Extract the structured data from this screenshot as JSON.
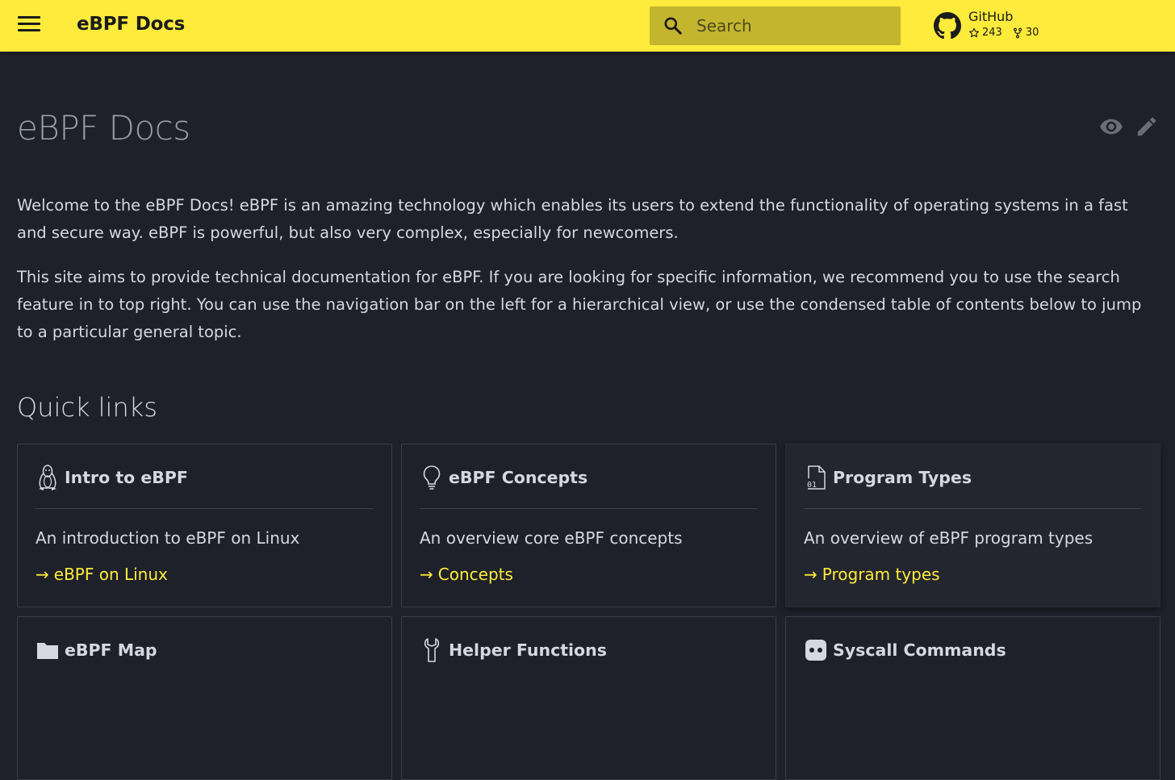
{
  "header": {
    "site_title": "eBPF Docs",
    "search_placeholder": "Search",
    "repo": {
      "name": "GitHub",
      "stars": "243",
      "forks": "30"
    },
    "accent_color": "#ffeb3b"
  },
  "page": {
    "title": "eBPF Docs",
    "paragraphs": [
      "Welcome to the eBPF Docs! eBPF is an amazing technology which enables its users to extend the functionality of operating systems in a fast and secure way. eBPF is powerful, but also very complex, especially for newcomers.",
      "This site aims to provide technical documentation for eBPF. If you are looking for specific information, we recommend you to use the search feature in to top right. You can use the navigation bar on the left for a hierarchical view, or use the condensed table of contents below to jump to a particular general topic."
    ],
    "quick_links_heading": "Quick links"
  },
  "cards": [
    {
      "icon": "linux-penguin-icon",
      "title": "Intro to eBPF",
      "description": "An introduction to eBPF on Linux",
      "link_label": "eBPF on Linux"
    },
    {
      "icon": "lightbulb-icon",
      "title": "eBPF Concepts",
      "description": "An overview core eBPF concepts",
      "link_label": "Concepts"
    },
    {
      "icon": "binary-file-icon",
      "title": "Program Types",
      "description": "An overview of eBPF program types",
      "link_label": "Program types"
    },
    {
      "icon": "folder-icon",
      "title": "eBPF Map"
    },
    {
      "icon": "wrench-icon",
      "title": "Helper Functions"
    },
    {
      "icon": "syscall-icon",
      "title": "Syscall Commands"
    }
  ],
  "link_arrow": "→"
}
